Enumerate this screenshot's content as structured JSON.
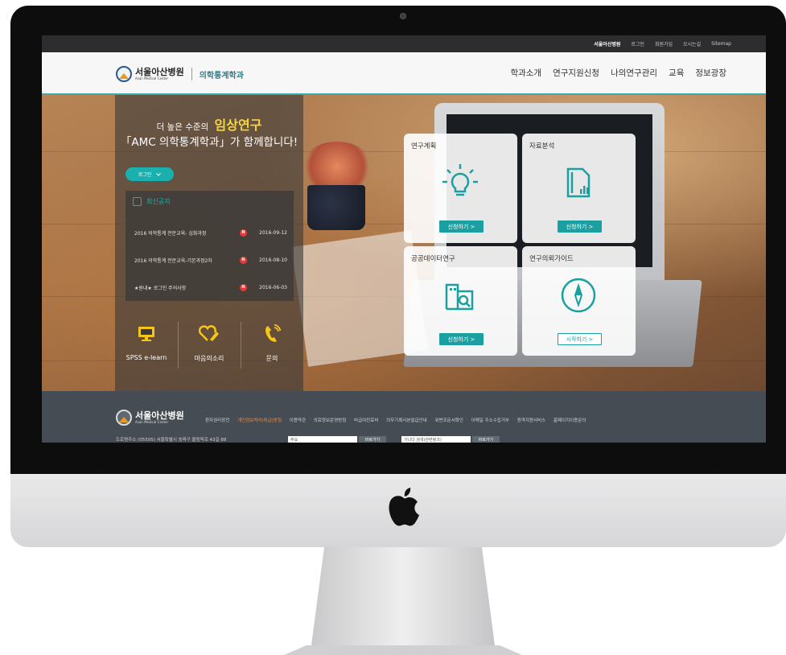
{
  "utility_bar": {
    "items": [
      "서울아산병원",
      "로그인",
      "회원가입",
      "오시는길",
      "Sitemap"
    ]
  },
  "header": {
    "logo_ko": "서울아산병원",
    "logo_en": "Asan Medical Center",
    "dept": "의학통계학과",
    "menu": [
      "학과소개",
      "연구지원신청",
      "나의연구관리",
      "교육",
      "정보광장"
    ]
  },
  "hero": {
    "tagline_prefix": "더 높은 수준의",
    "tagline_highlight": "임상연구",
    "tagline_main": "「AMC 의학통계학과」가 함께합니다!",
    "login_label": "로그인"
  },
  "notices": {
    "title": "최신공지",
    "items": [
      {
        "title": "2016 의학통계 전문교육- 심화과정",
        "badge": "N",
        "date": "2016-09-12"
      },
      {
        "title": "2016 의학통계 전문교육-기본과정2차",
        "badge": "N",
        "date": "2016-08-10"
      },
      {
        "title": "★원내★ 로그인 주의사항",
        "badge": "N",
        "date": "2016-06-03"
      }
    ]
  },
  "quick_links": [
    {
      "label": "SPSS e-learn",
      "icon": "monitor-icon"
    },
    {
      "label": "마음의소리",
      "icon": "heart-pen-icon"
    },
    {
      "label": "문의",
      "icon": "phone-icon"
    }
  ],
  "cards": [
    {
      "title": "연구계획",
      "button": "신청하기 >",
      "icon": "lightbulb-icon"
    },
    {
      "title": "자료분석",
      "button": "신청하기 >",
      "icon": "document-chart-icon"
    },
    {
      "title": "공공데이터연구",
      "button": "신청하기 >",
      "icon": "building-search-icon"
    },
    {
      "title": "연구의뢰가이드",
      "button": "시작하기 >",
      "icon": "compass-icon"
    }
  ],
  "footer": {
    "logo_ko": "서울아산병원",
    "logo_en": "Asan Medical Center",
    "links": [
      "환자권리장전",
      "개인정보처리(취급)방침",
      "이용약관",
      "의료정보운영방침",
      "비급여진료비",
      "의무기록사본발급안내",
      "위변조문서확인",
      "이메일 주소수집거부",
      "원격지원서비스",
      "홈페이지이용문의"
    ],
    "address": "도로명주소 (05505) 서울특별시 송파구 올림픽로 43길 88",
    "select1": "주요",
    "select2": "가나다 검색(관련링크)",
    "go_label": "바로가기"
  },
  "colors": {
    "accent": "#1bb0b0",
    "highlight": "#f5d63c",
    "footer_bg": "#454c54",
    "badge_red": "#e33b3b"
  }
}
